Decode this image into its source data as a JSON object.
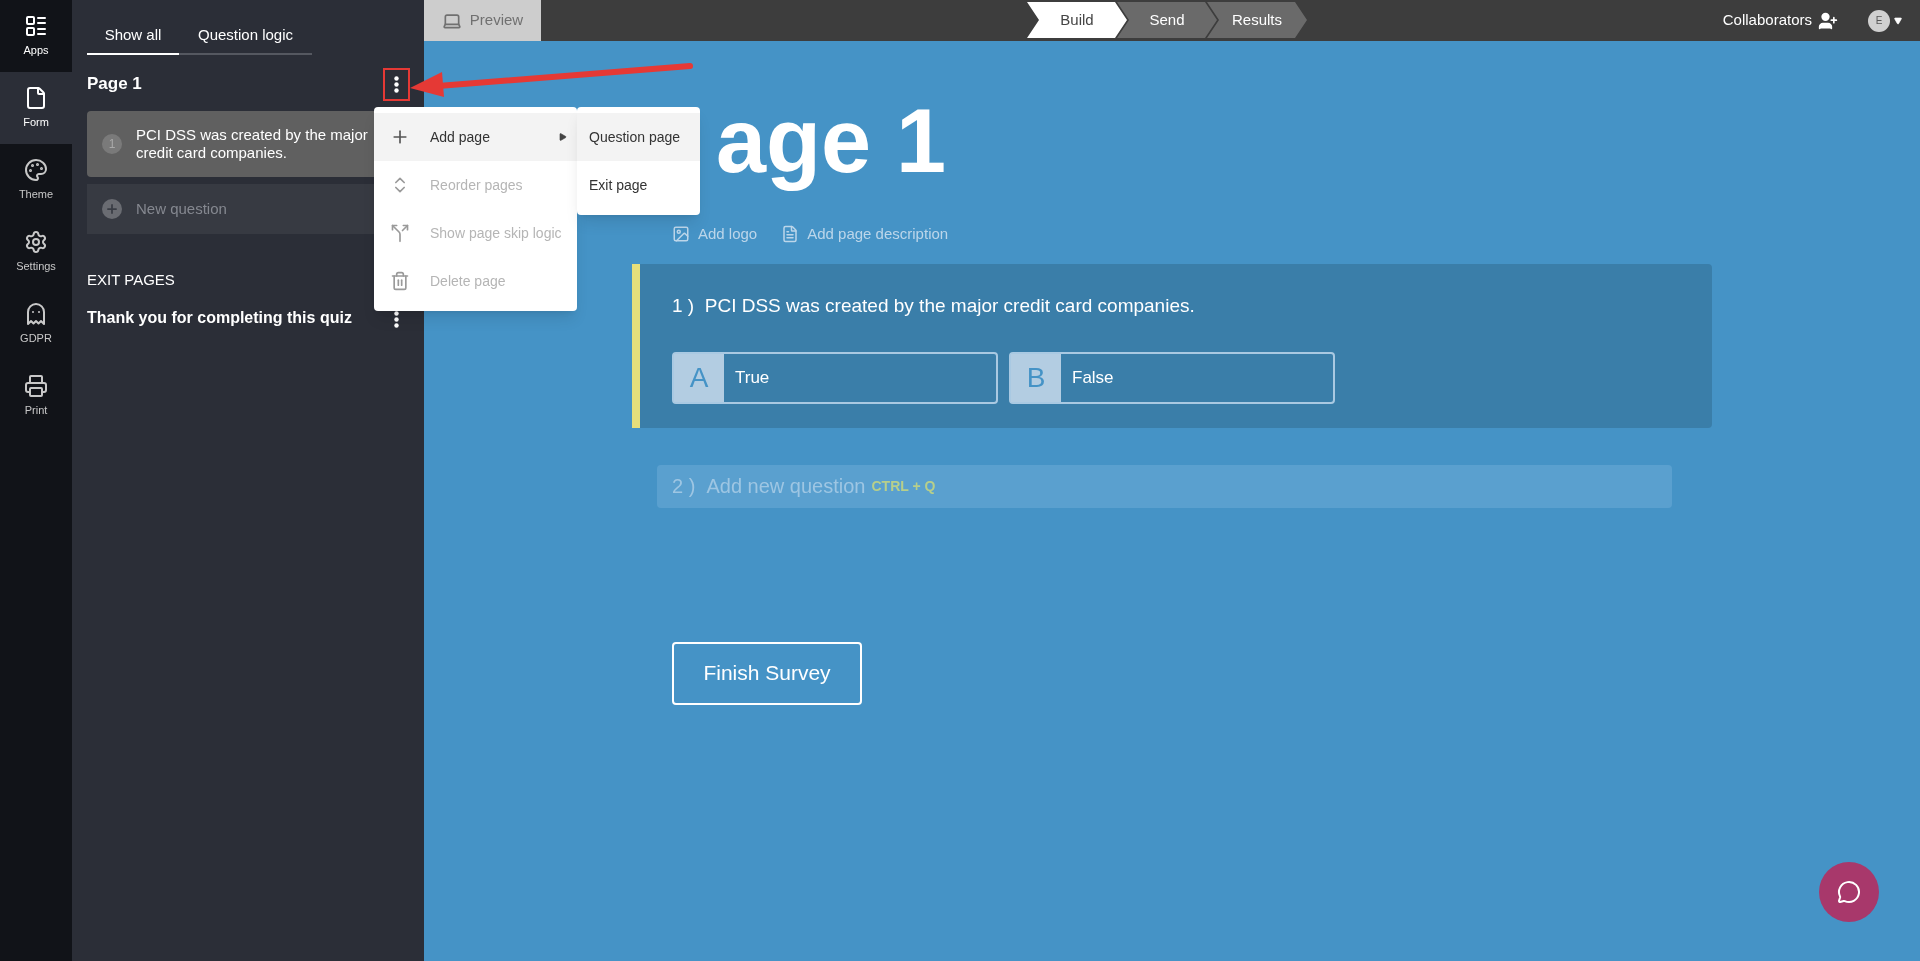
{
  "rail": {
    "items": [
      {
        "label": "Apps",
        "selected": false
      },
      {
        "label": "Form",
        "selected": true
      },
      {
        "label": "Theme",
        "selected": false
      },
      {
        "label": "Settings",
        "selected": false
      },
      {
        "label": "GDPR",
        "selected": false
      },
      {
        "label": "Print",
        "selected": false
      }
    ]
  },
  "sidebar": {
    "tabs": [
      {
        "label": "Show all",
        "selected": true
      },
      {
        "label": "Question logic",
        "selected": false
      }
    ],
    "pages": [
      {
        "title": "Page 1",
        "menu_highlighted": true,
        "questions": [
          {
            "number": "1",
            "text": "PCI DSS was created by the major credit card companies."
          }
        ],
        "new_question": "New question"
      }
    ],
    "exit_heading": "EXIT PAGES",
    "exit_pages": [
      "Thank you for completing this quiz"
    ]
  },
  "page_menu": {
    "items": [
      {
        "label": "Add page",
        "disabled": false,
        "submenu": true,
        "highlighted": true
      },
      {
        "label": "Reorder pages",
        "disabled": true,
        "submenu": false,
        "highlighted": false
      },
      {
        "label": "Show page skip logic",
        "disabled": true,
        "submenu": false,
        "highlighted": false
      },
      {
        "label": "Delete page",
        "disabled": true,
        "submenu": false,
        "highlighted": false
      }
    ],
    "submenu": [
      {
        "label": "Question page",
        "highlighted": true
      },
      {
        "label": "Exit page",
        "highlighted": false
      }
    ]
  },
  "topbar": {
    "preview": "Preview",
    "steps": [
      {
        "label": "Build",
        "selected": true
      },
      {
        "label": "Send",
        "selected": false
      },
      {
        "label": "Results",
        "selected": false
      }
    ],
    "collaborators": "Collaborators",
    "avatar": "E"
  },
  "main": {
    "page_title": "age 1",
    "tools": [
      {
        "label": "Add logo"
      },
      {
        "label": "Add page description"
      }
    ],
    "question": {
      "number": "1 )",
      "text": "PCI DSS was created by the major credit card companies.",
      "options": [
        {
          "letter": "A",
          "label": "True"
        },
        {
          "letter": "B",
          "label": "False"
        }
      ]
    },
    "new_question": {
      "number": "2 )",
      "text": "Add new question",
      "shortcut": "CTRL + Q"
    },
    "finish_button": "Finish Survey"
  }
}
